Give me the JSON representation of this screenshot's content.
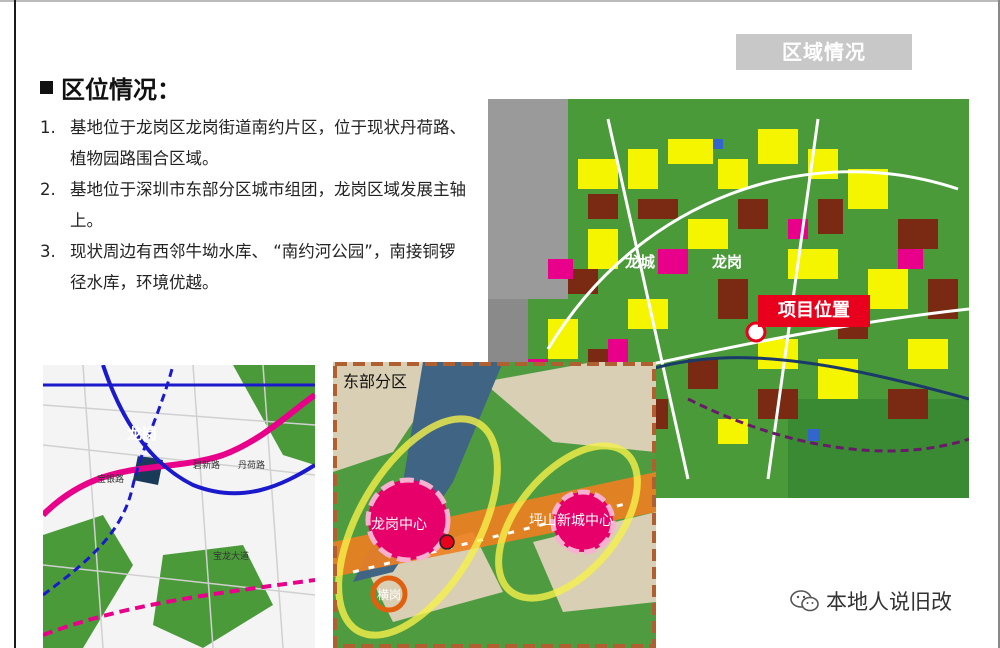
{
  "region_tag": "区域情况",
  "heading": "区位情况：",
  "items": [
    {
      "num": "1.",
      "text": "基地位于龙岗区龙岗街道南约片区，位于现状丹荷路、植物园路围合区域。"
    },
    {
      "num": "2.",
      "text": "基地位于深圳市东部分区城市组团，龙岗区域发展主轴上。"
    },
    {
      "num": "3.",
      "text": "现状周边有西邻牛坳水库、 “南约河公园”，南接铜锣径水库，环境优越。"
    }
  ],
  "main_map": {
    "label_longcheng": "龙城",
    "label_longgang": "龙岗",
    "callout": "项目位置"
  },
  "left_map": {
    "label_longgang": "龙岗",
    "label_baoyin": "宝银路",
    "label_bixin": "碧新路",
    "label_danhe": "丹荷路",
    "label_baolong": "宝龙大道"
  },
  "mid_map": {
    "title": "东部分区",
    "center1": "龙岗中心",
    "center2": "坪山新城中心",
    "small": "横岗"
  },
  "watermark": "本地人说旧改",
  "colors": {
    "callout": "#e8001c",
    "magenta": "#e8008a",
    "yellow": "#f5f500",
    "brown": "#7a2a12",
    "green": "#4a9a3a",
    "tag_bg": "#c8c8c8"
  }
}
